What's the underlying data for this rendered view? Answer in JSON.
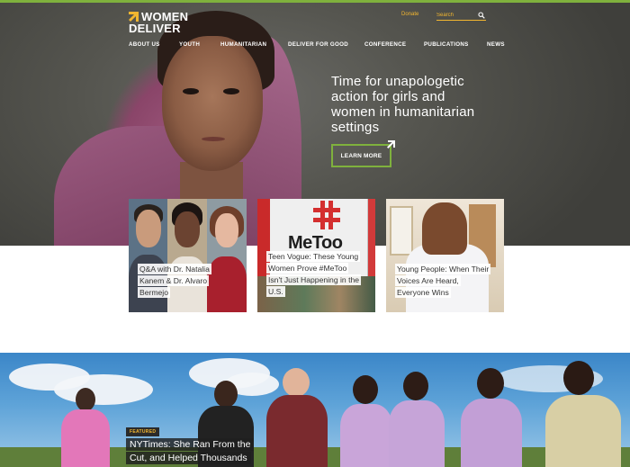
{
  "header": {
    "logo_line1": "WOMEN",
    "logo_line2": "DELIVER",
    "donate_label": "Donate",
    "search_placeholder": "Search"
  },
  "nav": {
    "items": [
      {
        "label": "ABOUT US"
      },
      {
        "label": "YOUTH"
      },
      {
        "label": "HUMANITARIAN"
      },
      {
        "label": "DELIVER FOR GOOD"
      },
      {
        "label": "CONFERENCE"
      },
      {
        "label": "PUBLICATIONS"
      },
      {
        "label": "NEWS"
      }
    ]
  },
  "hero": {
    "headline": "Time for unapologetic action for girls and women in humanitarian settings",
    "cta_label": "LEARN MORE"
  },
  "cards": [
    {
      "caption_lines": [
        "Q&A with Dr. Natalia",
        "Kanem & Dr. Alvaro",
        "Bermejo"
      ]
    },
    {
      "caption_lines": [
        "Teen Vogue: These Young",
        "Women Prove #MeToo",
        "Isn't Just Happening in the",
        "U.S."
      ],
      "image_text": "MeToo"
    },
    {
      "caption_lines": [
        "Young People: When Their",
        "Voices Are Heard,",
        "Everyone Wins"
      ]
    }
  ],
  "feature": {
    "tag": "FEATURED",
    "title_lines": [
      "NYTimes: She Ran From the",
      "Cut, and Helped Thousands"
    ]
  },
  "colors": {
    "brand_green": "#7fb13d",
    "brand_gold": "#f2b630",
    "dark_text": "#333333"
  },
  "icons": [
    "logo-arrow-icon",
    "search-icon",
    "external-arrow-icon"
  ]
}
